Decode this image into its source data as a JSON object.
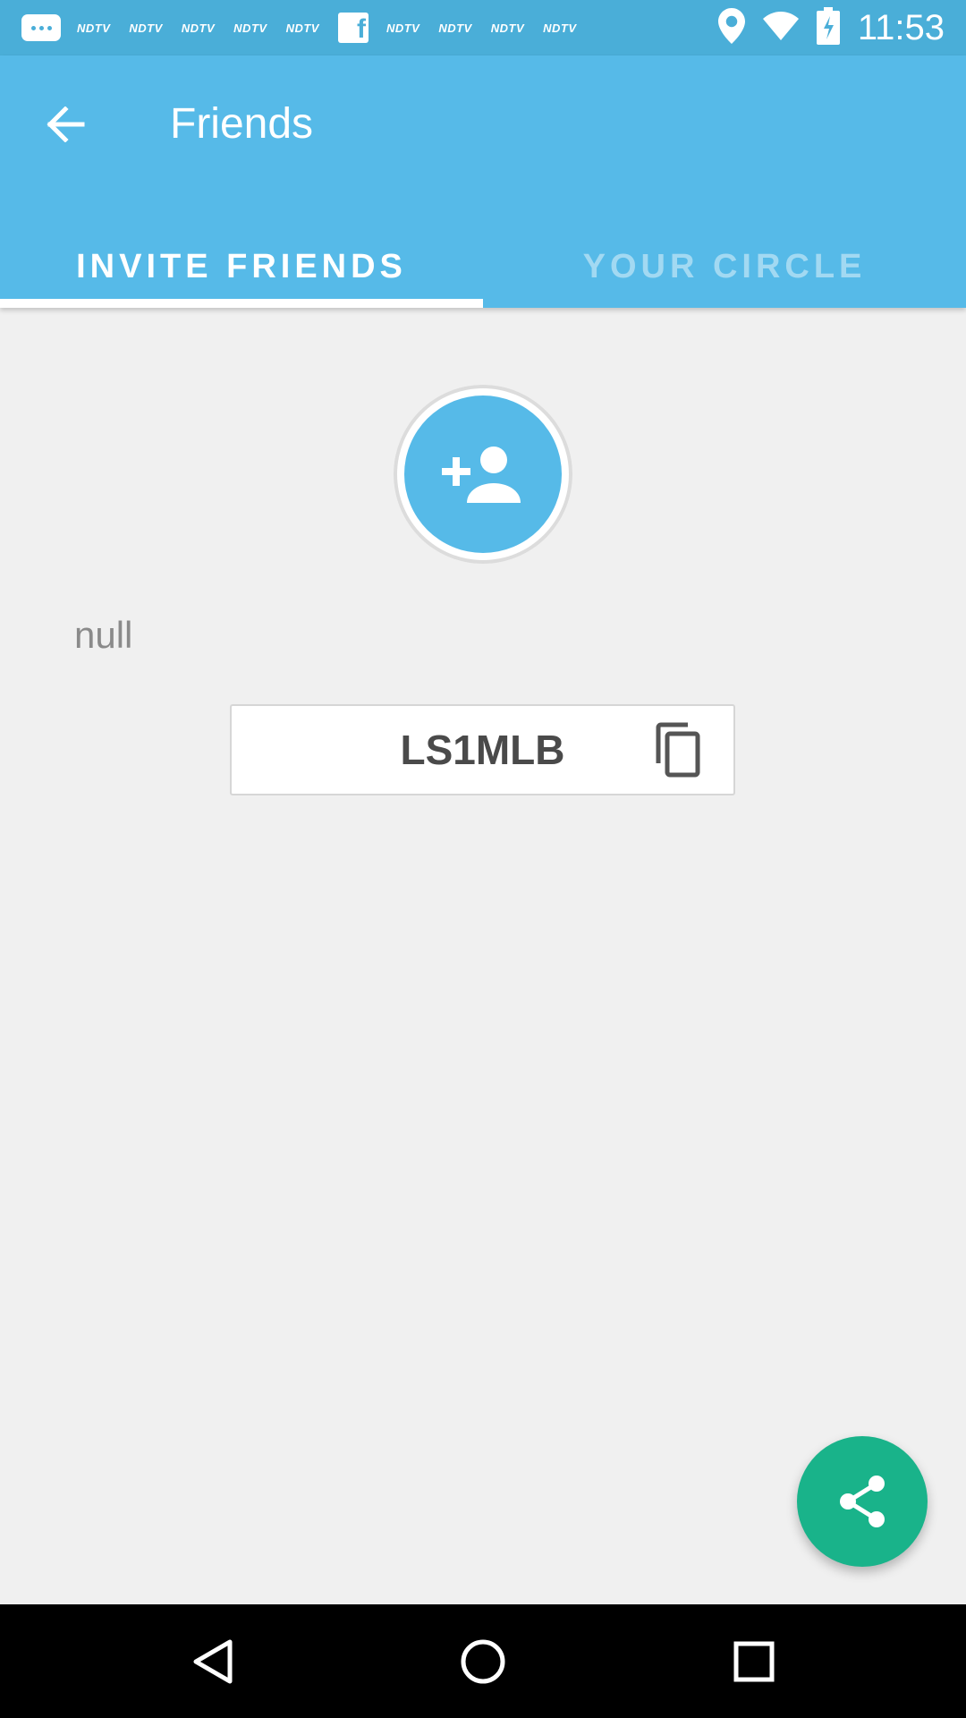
{
  "status_bar": {
    "notification_label": "NDTV",
    "time": "11:53",
    "icons": [
      "messages-icon",
      "facebook-icon",
      "location-icon",
      "wifi-icon",
      "battery-icon"
    ]
  },
  "app_bar": {
    "title": "Friends",
    "back_icon": "arrow-back-icon",
    "color": "#56bae8"
  },
  "tabs": [
    {
      "label": "INVITE FRIENDS",
      "selected": true
    },
    {
      "label": "YOUR CIRCLE",
      "selected": false
    }
  ],
  "content": {
    "avatar_icon": "person-add-icon",
    "name_text": "null",
    "invite_code": "LS1MLB",
    "copy_icon": "copy-icon"
  },
  "fab": {
    "icon": "share-icon",
    "color": "#19b38a"
  },
  "nav_bar": {
    "icons": [
      "back-triangle-icon",
      "home-circle-icon",
      "recents-square-icon"
    ]
  }
}
